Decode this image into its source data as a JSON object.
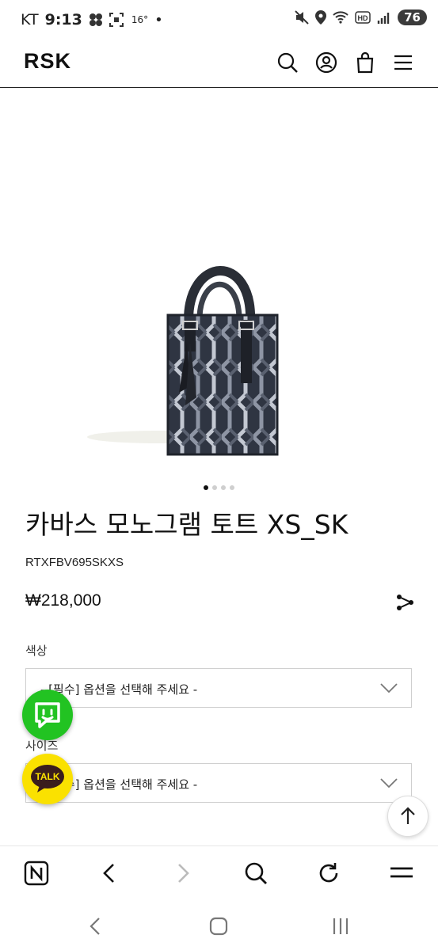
{
  "status_bar": {
    "carrier": "KT",
    "time": "9:13",
    "temperature": "16°",
    "battery": "76"
  },
  "header": {
    "logo": "RSK"
  },
  "gallery": {
    "total": 4,
    "active": 0
  },
  "product": {
    "name": "카바스 모노그램 토트 XS_SK",
    "code": "RTXFBV695SKXS",
    "price": "₩218,000"
  },
  "options": [
    {
      "label": "색상",
      "value": "- [필수] 옵션을 선택해 주세요 -"
    },
    {
      "label": "사이즈",
      "value": "- [필수] 옵션을 선택해 주세요 -"
    }
  ],
  "floating": {
    "talk_label": "TALK"
  },
  "colors": {
    "accent_green": "#22c322",
    "kakao_yellow": "#fae100"
  }
}
